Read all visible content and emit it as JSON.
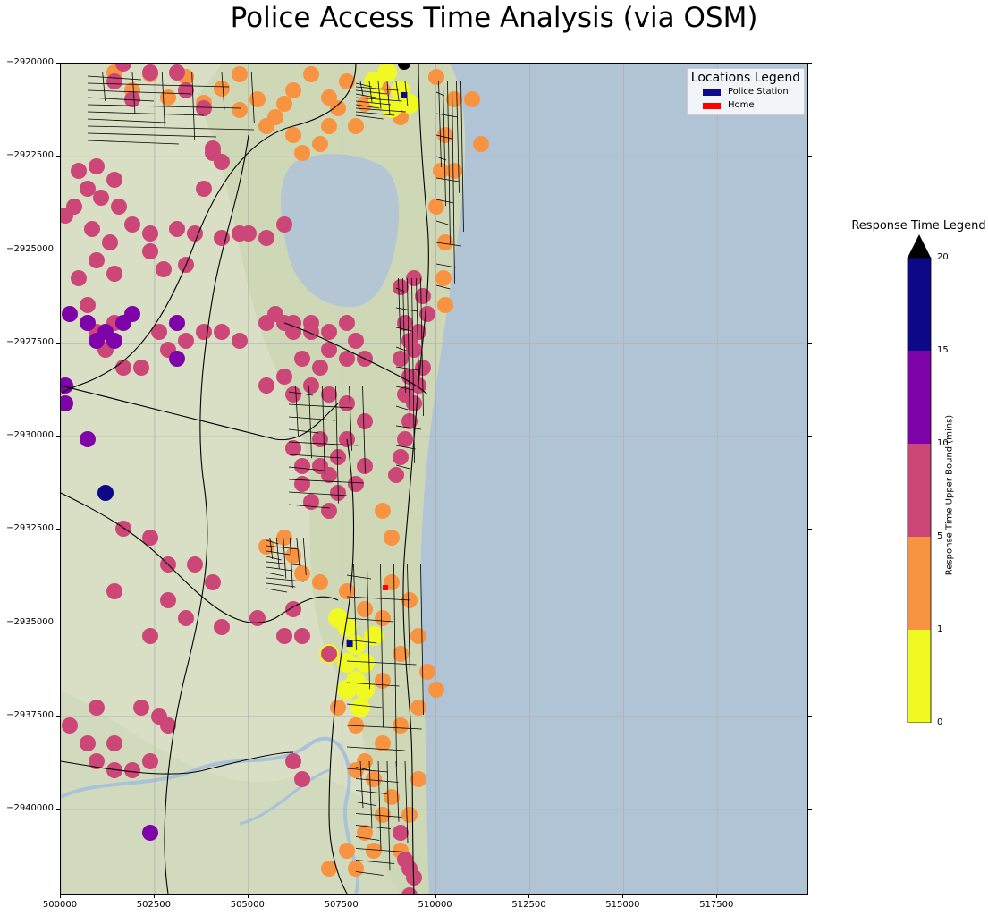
{
  "title": "Police Access Time Analysis (via OSM)",
  "map": {
    "x_ticks": [
      "500000",
      "502500",
      "505000",
      "507500",
      "510000",
      "512500",
      "515000",
      "517500"
    ],
    "y_ticks": [
      "−2920000",
      "−2922500",
      "−2925000",
      "−2927500",
      "−2930000",
      "−2932500",
      "−2935000",
      "−2937500",
      "−2940000"
    ],
    "xlim": [
      500000,
      519900
    ],
    "ylim": [
      -2942250,
      -2920000
    ],
    "colors": {
      "sea": "#b0c4d6",
      "land": "#d9dfc4",
      "lake": "#b4c6d4",
      "roads": "#000000",
      "grid": "#b0b0b0"
    }
  },
  "locations_legend": {
    "title": "Locations Legend",
    "entries": [
      {
        "label": "Police Station",
        "color": "#0a0a8a"
      },
      {
        "label": "Home",
        "color": "#ff0000"
      }
    ]
  },
  "police_stations": [
    {
      "x": 509150,
      "y": -2920850
    },
    {
      "x": 507700,
      "y": -2935550
    }
  ],
  "home": {
    "x": 508650,
    "y": -2934050
  },
  "response_legend": {
    "title": "Response Time Legend",
    "axis_label": "Response Time Upper Bound (mins)",
    "ticks": [
      "0",
      "1",
      "5",
      "10",
      "15",
      "20"
    ],
    "bins": [
      {
        "range": "0-1",
        "color": "#f0f921"
      },
      {
        "range": "1-5",
        "color": "#f89441"
      },
      {
        "range": "5-10",
        "color": "#cc4778"
      },
      {
        "range": "10-15",
        "color": "#7e03a8"
      },
      {
        "range": "15-20",
        "color": "#0d0887"
      }
    ],
    "extend_color": "#000000"
  }
}
